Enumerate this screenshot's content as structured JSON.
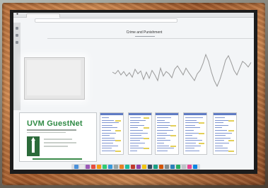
{
  "screen": {
    "chart_page": {
      "title": "Crime and Punishment"
    },
    "thumbnails": {
      "guestnet": {
        "title": "UVM GuestNet"
      }
    },
    "icons": [
      "apple-logo-icon",
      "dock-icon"
    ],
    "colors": {
      "frame": "#b8703c",
      "guestnet_green": "#2f8a44",
      "chart_line": "#9a9a9a",
      "doc_header": "#5f7bc4",
      "doc_highlight": "#e3cf57"
    }
  },
  "chart_data": {
    "type": "line",
    "title": "Crime and Punishment",
    "xlabel": "",
    "ylabel": "",
    "series": [
      {
        "values": [
          0.55,
          0.52,
          0.58,
          0.5,
          0.56,
          0.48,
          0.54,
          0.46,
          0.6,
          0.52,
          0.57,
          0.42,
          0.55,
          0.44,
          0.58,
          0.5,
          0.4,
          0.62,
          0.48,
          0.56,
          0.52,
          0.45,
          0.6,
          0.66,
          0.58,
          0.5,
          0.62,
          0.54,
          0.47,
          0.4,
          0.52,
          0.58,
          0.7,
          0.86,
          0.74,
          0.55,
          0.4,
          0.3,
          0.42,
          0.58,
          0.76,
          0.84,
          0.72,
          0.58,
          0.5,
          0.62,
          0.74,
          0.7,
          0.64,
          0.72
        ]
      }
    ],
    "grid": false
  }
}
